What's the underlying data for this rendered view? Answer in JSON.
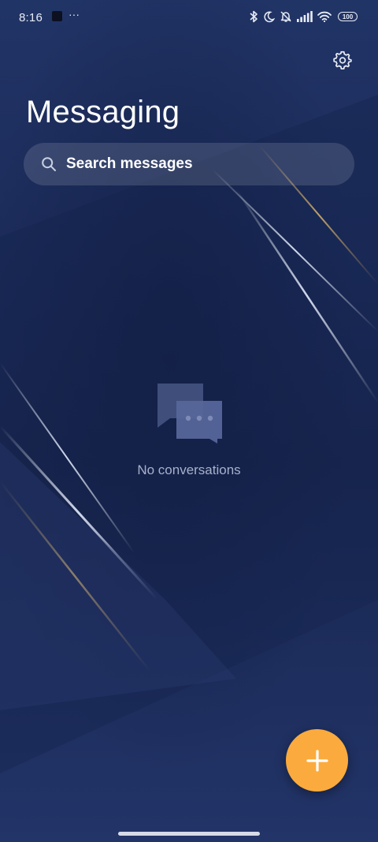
{
  "status_bar": {
    "time": "8:16",
    "left_icons": [
      "app-notification-icon",
      "more-dots-icon"
    ],
    "more_dots": "···",
    "right_icons": [
      "bluetooth-icon",
      "do-not-disturb-moon-icon",
      "muted-bell-icon",
      "cellular-signal-icon",
      "wifi-icon",
      "battery-icon"
    ],
    "battery_level": "100"
  },
  "header": {
    "title": "Messaging",
    "settings_icon": "gear-icon"
  },
  "search": {
    "placeholder": "Search messages",
    "icon": "search-icon"
  },
  "empty_state": {
    "icon": "chat-bubbles-icon",
    "label": "No conversations"
  },
  "fab": {
    "icon": "plus-icon",
    "color": "#fbab3d"
  },
  "colors": {
    "background": "#1f2f60",
    "accent": "#fbab3d",
    "muted_text": "#a8b1cc"
  }
}
